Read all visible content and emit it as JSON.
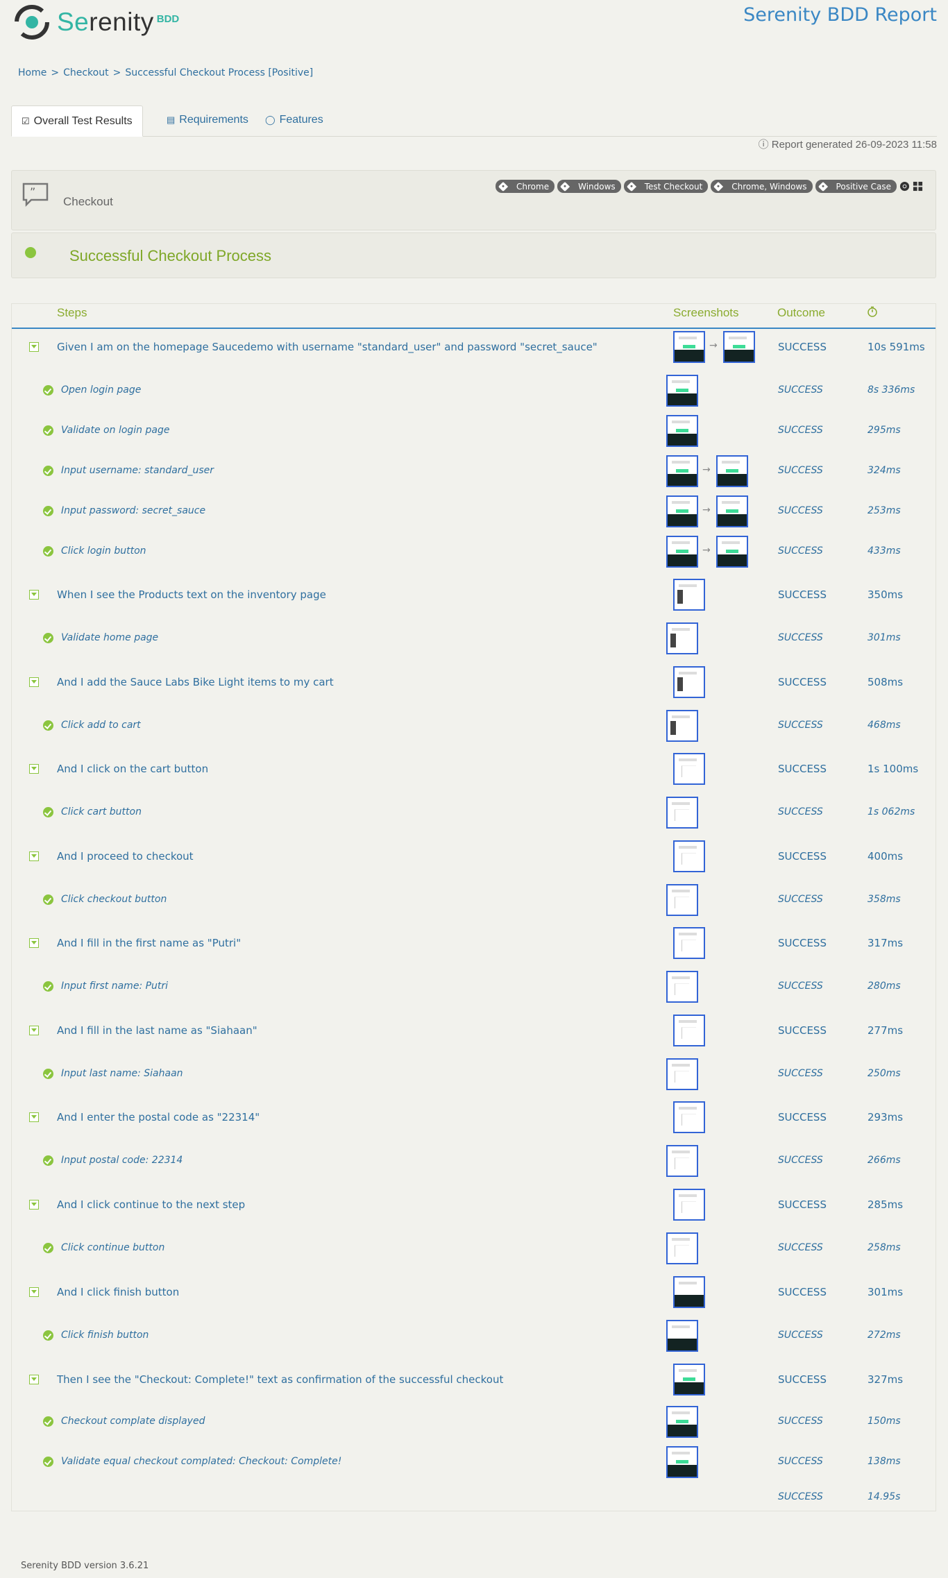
{
  "header": {
    "logo_text_1": "Se",
    "logo_text_2": "renity",
    "logo_sub": "BDD",
    "report_title": "Serenity BDD Report"
  },
  "breadcrumb": [
    "Home",
    "Checkout",
    "Successful Checkout Process [Positive]"
  ],
  "tabs": [
    {
      "label": "Overall Test Results",
      "icon": "checklist-icon"
    },
    {
      "label": "Requirements",
      "icon": "list-icon"
    },
    {
      "label": "Features",
      "icon": "comment-icon"
    }
  ],
  "generated": "Report generated 26-09-2023 11:58",
  "feature": {
    "name": "Checkout",
    "tags": [
      "Chrome",
      "Windows",
      "Test Checkout",
      "Chrome, Windows",
      "Positive Case"
    ]
  },
  "scenario": {
    "title": "Successful Checkout Process"
  },
  "table": {
    "headers": {
      "steps": "Steps",
      "screenshots": "Screenshots",
      "outcome": "Outcome"
    },
    "rows": [
      {
        "level": "main",
        "text": "Given I am on the homepage Saucedemo with username \"standard_user\" and password \"secret_sauce\"",
        "outcome": "SUCCESS",
        "duration": "10s 591ms"
      },
      {
        "level": "sub",
        "text": "Open login page",
        "outcome": "SUCCESS",
        "duration": "8s 336ms"
      },
      {
        "level": "sub",
        "text": "Validate on login page",
        "outcome": "SUCCESS",
        "duration": "295ms"
      },
      {
        "level": "sub",
        "text": "Input username: standard_user",
        "outcome": "SUCCESS",
        "duration": "324ms"
      },
      {
        "level": "sub",
        "text": "Input password: secret_sauce",
        "outcome": "SUCCESS",
        "duration": "253ms"
      },
      {
        "level": "sub",
        "text": "Click login button",
        "outcome": "SUCCESS",
        "duration": "433ms"
      },
      {
        "level": "main",
        "text": "When I see the Products text on the inventory page",
        "outcome": "SUCCESS",
        "duration": "350ms"
      },
      {
        "level": "sub",
        "text": "Validate home page",
        "outcome": "SUCCESS",
        "duration": "301ms"
      },
      {
        "level": "main",
        "text": "And I add the Sauce Labs Bike Light items to my cart",
        "outcome": "SUCCESS",
        "duration": "508ms"
      },
      {
        "level": "sub",
        "text": "Click add to cart",
        "outcome": "SUCCESS",
        "duration": "468ms"
      },
      {
        "level": "main",
        "text": "And I click on the cart button",
        "outcome": "SUCCESS",
        "duration": "1s 100ms"
      },
      {
        "level": "sub",
        "text": "Click cart button",
        "outcome": "SUCCESS",
        "duration": "1s 062ms"
      },
      {
        "level": "main",
        "text": "And I proceed to checkout",
        "outcome": "SUCCESS",
        "duration": "400ms"
      },
      {
        "level": "sub",
        "text": "Click checkout button",
        "outcome": "SUCCESS",
        "duration": "358ms"
      },
      {
        "level": "main",
        "text": "And I fill in the first name as \"Putri\"",
        "outcome": "SUCCESS",
        "duration": "317ms"
      },
      {
        "level": "sub",
        "text": "Input first name: Putri",
        "outcome": "SUCCESS",
        "duration": "280ms"
      },
      {
        "level": "main",
        "text": "And I fill in the last name as \"Siahaan\"",
        "outcome": "SUCCESS",
        "duration": "277ms"
      },
      {
        "level": "sub",
        "text": "Input last name: Siahaan",
        "outcome": "SUCCESS",
        "duration": "250ms"
      },
      {
        "level": "main",
        "text": "And I enter the postal code as \"22314\"",
        "outcome": "SUCCESS",
        "duration": "293ms"
      },
      {
        "level": "sub",
        "text": "Input postal code: 22314",
        "outcome": "SUCCESS",
        "duration": "266ms"
      },
      {
        "level": "main",
        "text": "And I click continue to the next step",
        "outcome": "SUCCESS",
        "duration": "285ms"
      },
      {
        "level": "sub",
        "text": "Click continue button",
        "outcome": "SUCCESS",
        "duration": "258ms"
      },
      {
        "level": "main",
        "text": "And I click finish button",
        "outcome": "SUCCESS",
        "duration": "301ms"
      },
      {
        "level": "sub",
        "text": "Click finish button",
        "outcome": "SUCCESS",
        "duration": "272ms"
      },
      {
        "level": "main",
        "text": "Then I see the \"Checkout: Complete!\" text as confirmation of the successful checkout",
        "outcome": "SUCCESS",
        "duration": "327ms"
      },
      {
        "level": "sub",
        "text": "Checkout complate displayed",
        "outcome": "SUCCESS",
        "duration": "150ms"
      },
      {
        "level": "sub",
        "text": "Validate equal checkout complated: Checkout: Complete!",
        "outcome": "SUCCESS",
        "duration": "138ms"
      }
    ],
    "total": {
      "outcome": "SUCCESS",
      "duration": "14.95s"
    }
  },
  "footer": "Serenity BDD version 3.6.21",
  "colors": {
    "accent": "#3a87c4",
    "success": "#8bc53f",
    "brand": "#33b5a4"
  }
}
